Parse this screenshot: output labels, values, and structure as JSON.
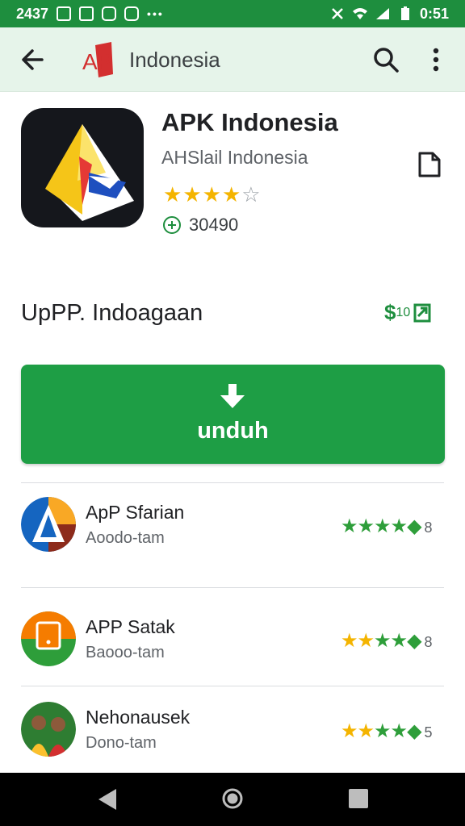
{
  "status_bar": {
    "time_left": "2437",
    "time_right": "0:51",
    "colors": {
      "background": "#1e8e3e"
    }
  },
  "app_bar": {
    "logo_text": "AP",
    "brand_name": "Indonesia"
  },
  "app": {
    "title": "APK Indonesia",
    "developer": "AHSlail Indonesia",
    "rating": 3.5,
    "downloads": "30490"
  },
  "section": {
    "title": "UpPP. Indoagaan",
    "price_symbol": "$",
    "price_value": "10"
  },
  "download_button": {
    "label": "unduh"
  },
  "list": [
    {
      "title": "ApP Sfarian",
      "subtitle": "Aoodo-tam",
      "tail": "8"
    },
    {
      "title": "APP Satak",
      "subtitle": "Baooo-tam",
      "tail": "8"
    },
    {
      "title": "Nehonausek",
      "subtitle": "Dono-tam",
      "tail": "5"
    }
  ],
  "colors": {
    "accent_green": "#1e9e45",
    "app_bar_bg": "#e6f4ea",
    "star_yellow": "#f4b400"
  }
}
